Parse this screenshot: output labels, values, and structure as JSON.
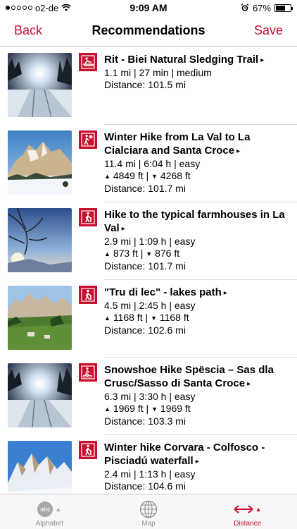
{
  "status": {
    "carrier": "o2-de",
    "time": "9:09 AM",
    "battery": "67%",
    "battery_level": 0.67
  },
  "nav": {
    "back": "Back",
    "title": "Recommendations",
    "save": "Save"
  },
  "items": [
    {
      "title": "Rit - Biei Natural Sledging Trail",
      "icon": "sledge-icon",
      "stats": "1.1 mi | 27 min | medium",
      "distance": "Distance: 101.5 mi",
      "image": "winter-forest-path"
    },
    {
      "title": "Winter Hike from La Val to La Cialciara and Santa Croce",
      "icon": "winter-hiker-icon",
      "stats": "11.4 mi | 6:04 h | easy",
      "up": "4849 ft",
      "down": "4268 ft",
      "distance": "Distance: 101.7 mi",
      "image": "snowy-mountain"
    },
    {
      "title": "Hike to the typical farmhouses in La Val",
      "icon": "hiker-icon",
      "stats": "2.9 mi | 1:09 h | easy",
      "up": "873 ft",
      "down": "876 ft",
      "distance": "Distance: 101.7 mi",
      "image": "bare-tree-sunset"
    },
    {
      "title": "\"Tru di lec\" - lakes path",
      "icon": "hiker-icon",
      "stats": "4.5 mi | 2:45 h | easy",
      "up": "1168 ft",
      "down": "1168 ft",
      "distance": "Distance: 102.6 mi",
      "image": "green-valley"
    },
    {
      "title": "Snowshoe Hike Spëscia – Sas dla Crusc/Sasso di Santa Croce",
      "icon": "snowshoe-icon",
      "stats": "6.3 mi | 3:30 h | easy",
      "up": "1969 ft",
      "down": "1969 ft",
      "distance": "Distance: 103.3 mi",
      "image": "winter-forest-path"
    },
    {
      "title": "Winter hike Corvara - Colfosco - Pisciadú waterfall",
      "icon": "hiker-icon",
      "stats": "2.4 mi | 1:13 h | easy",
      "distance": "Distance: 104.6 mi",
      "image": "snowy-peaks-blue-sky"
    }
  ],
  "tabs": [
    {
      "label": "Alphabet",
      "badge": "abc",
      "icon": "alphabet-icon"
    },
    {
      "label": "Map",
      "icon": "globe-icon"
    },
    {
      "label": "Distance",
      "icon": "distance-arrows-icon"
    }
  ],
  "colors": {
    "accent": "#c8102e"
  }
}
